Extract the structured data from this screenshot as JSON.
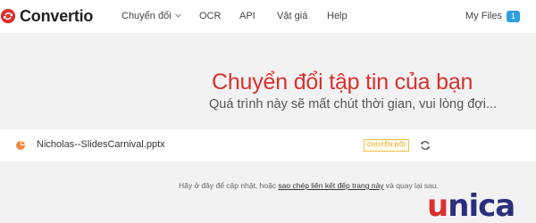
{
  "brand": {
    "name": "Convertio",
    "accent": "#d9312e"
  },
  "nav": {
    "convert": "Chuyển đổi",
    "ocr": "OCR",
    "api": "API",
    "pricing": "Vật giá",
    "help": "Help",
    "my_files": "My Files",
    "my_files_count": "1"
  },
  "hero": {
    "title": "Chuyển đổi tập tin của bạn",
    "subtitle": "Quá trình này sẽ mất chút thời gian, vui lòng đợi..."
  },
  "file": {
    "name": "Nicholas--SlidesCarnival.pptx",
    "status": "CHUYỂN ĐỔI"
  },
  "notice": {
    "prefix": "Hãy ở đây để cập nhật, hoặc ",
    "link": "sao chép liên kết đếp trang này",
    "suffix": " và quay lại sau."
  },
  "watermark": {
    "letters": [
      "u",
      "n",
      "i",
      "c",
      "a"
    ]
  },
  "icons": {
    "logo": "convertio-logo-icon",
    "chevron": "chevron-down-icon",
    "file_type": "pie-chart-icon",
    "refresh": "refresh-icon"
  }
}
